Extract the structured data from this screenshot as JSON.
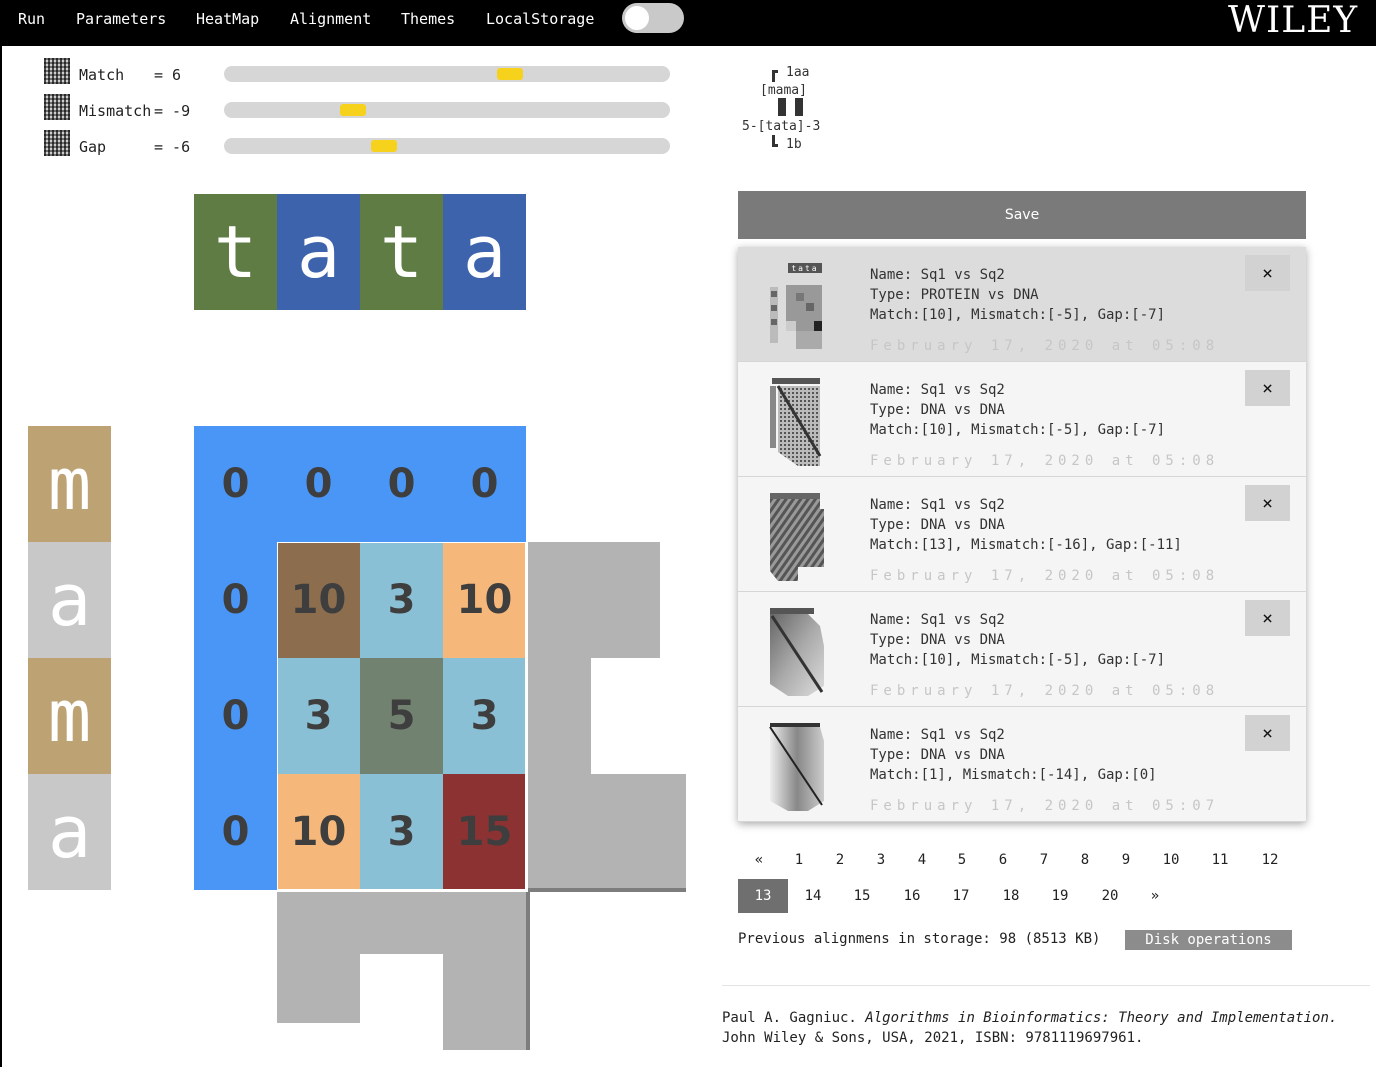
{
  "menu": {
    "items": [
      "Run",
      "Parameters",
      "HeatMap",
      "Alignment",
      "Themes",
      "LocalStorage"
    ],
    "logo": "WILEY",
    "toggle_on": false
  },
  "params": [
    {
      "label": "Match",
      "eq": "= 6",
      "value": 6
    },
    {
      "label": "Mismatch",
      "eq": "= -9",
      "value": -9
    },
    {
      "label": "Gap",
      "eq": "= -6",
      "value": -6
    }
  ],
  "seq_top": [
    "t",
    "a",
    "t",
    "a"
  ],
  "seq_left": [
    "m",
    "a",
    "m",
    "a"
  ],
  "matrix": [
    [
      "0",
      "0",
      "0",
      "0"
    ],
    [
      "0",
      "10",
      "3",
      "10"
    ],
    [
      "0",
      "3",
      "5",
      "3"
    ],
    [
      "0",
      "10",
      "3",
      "15"
    ]
  ],
  "tree": {
    "line1": "1aa",
    "line2": "[mama]",
    "line3": "5-[tata]-3",
    "line4": "1b"
  },
  "save_label": "Save",
  "saved": [
    {
      "name": "Name: Sq1 vs Sq2",
      "type": "Type: PROTEIN vs DNA",
      "params": "Match:[10], Mismatch:[-5], Gap:[-7]",
      "date": "February 17, 2020 at 05:08"
    },
    {
      "name": "Name: Sq1 vs Sq2",
      "type": "Type: DNA vs DNA",
      "params": "Match:[10], Mismatch:[-5], Gap:[-7]",
      "date": "February 17, 2020 at 05:08"
    },
    {
      "name": "Name: Sq1 vs Sq2",
      "type": "Type: DNA vs DNA",
      "params": "Match:[13], Mismatch:[-16], Gap:[-11]",
      "date": "February 17, 2020 at 05:08"
    },
    {
      "name": "Name: Sq1 vs Sq2",
      "type": "Type: DNA vs DNA",
      "params": "Match:[10], Mismatch:[-5], Gap:[-7]",
      "date": "February 17, 2020 at 05:08"
    },
    {
      "name": "Name: Sq1 vs Sq2",
      "type": "Type: DNA vs DNA",
      "params": "Match:[1], Mismatch:[-14], Gap:[0]",
      "date": "February 17, 2020 at 05:07"
    }
  ],
  "close_label": "×",
  "thumb_mini_label": "tata",
  "pagination": {
    "row1": [
      "«",
      "1",
      "2",
      "3",
      "4",
      "5",
      "6",
      "7",
      "8",
      "9",
      "10",
      "11",
      "12"
    ],
    "row2": [
      "13",
      "14",
      "15",
      "16",
      "17",
      "18",
      "19",
      "20",
      "»"
    ],
    "active": "13"
  },
  "storage_text": "Previous alignmens in storage: 98 (8513 KB)",
  "disk_label": "Disk operations",
  "citation": {
    "author": "Paul A. Gagniuc.",
    "title": "Algorithms in Bioinformatics: Theory and Implementation.",
    "publisher": "John Wiley & Sons, USA, 2021, ISBN: 9781119697961."
  },
  "colors": {
    "green": "#5e7c44",
    "blue": "#3e63ad",
    "tan": "#bda274",
    "lightgray": "#c8c8c8",
    "matrix_blue": "#4a96f7",
    "brown": "#8c6d4d",
    "lightblue": "#8ac0d5",
    "orange": "#f6b77a",
    "olive": "#718270",
    "darkred": "#8c3233",
    "slider_thumb": "#f7d21d"
  }
}
